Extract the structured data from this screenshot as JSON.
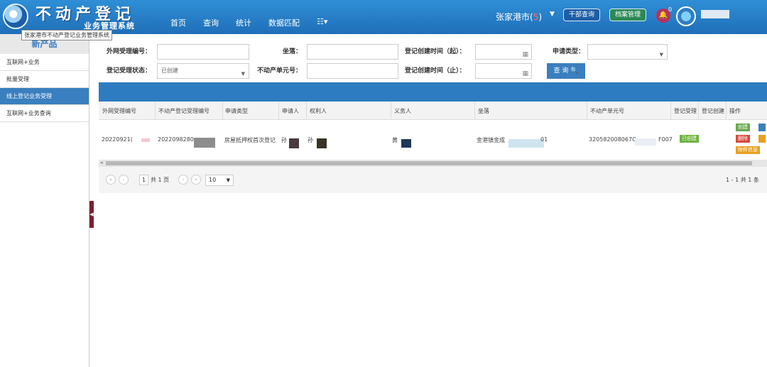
{
  "header": {
    "title": "不动产登记",
    "subtitle": "业务管理系统",
    "nav": [
      "首页",
      "查询",
      "统计",
      "数据匹配"
    ],
    "city": "张家港市(",
    "city_count": "5",
    "city_close": ")",
    "cadre_query": "干部查询",
    "archive_mgmt": "档案管理",
    "notify_count": "0"
  },
  "tooltip": "张家港市不动产登记业务管理系统",
  "sidebar": {
    "title": "新产品",
    "items": [
      "互联网+业务",
      "批量受理",
      "线上登记业务受理",
      "互联网+业务查询"
    ]
  },
  "form": {
    "ext_no_label": "外网受理编号：",
    "location_label": "坐落：",
    "created_from_label": "登记创建时间（起）：",
    "apply_type_label": "申请类型：",
    "status_label": "登记受理状态：",
    "status_value": "已创建",
    "unit_no_label": "不动产单元号：",
    "created_to_label": "登记创建时间（止）：",
    "search_label": "查 询"
  },
  "table": {
    "headers": [
      "外网受理编号",
      "不动产登记受理编号",
      "申请类型",
      "申请人",
      "权利人",
      "义务人",
      "坐落",
      "不动产单元号",
      "登记受理",
      "登记创建",
      "操作"
    ],
    "row": {
      "ext_no": "20220921(",
      "reg_no": "2022098280",
      "apply_type": "房屋抵押权首次登记",
      "applicant": "孙",
      "right_holder": "孙",
      "obligor": "黄",
      "location": "金港镇金成",
      "location_tail": "01",
      "unit_no": "320582008067C",
      "unit_tail": "F007",
      "status": "已创建",
      "actions": [
        "创建",
        "删除",
        "附件信息"
      ]
    }
  },
  "pager": {
    "page": "1",
    "total_pages": "共 1 页",
    "page_size": "10",
    "summary": "1 - 1  共 1 条"
  },
  "colors": {
    "header": "#2478c4",
    "accent": "#3a7fbf",
    "archive_btn": "#2a8a55",
    "bell": "#b8315c"
  }
}
